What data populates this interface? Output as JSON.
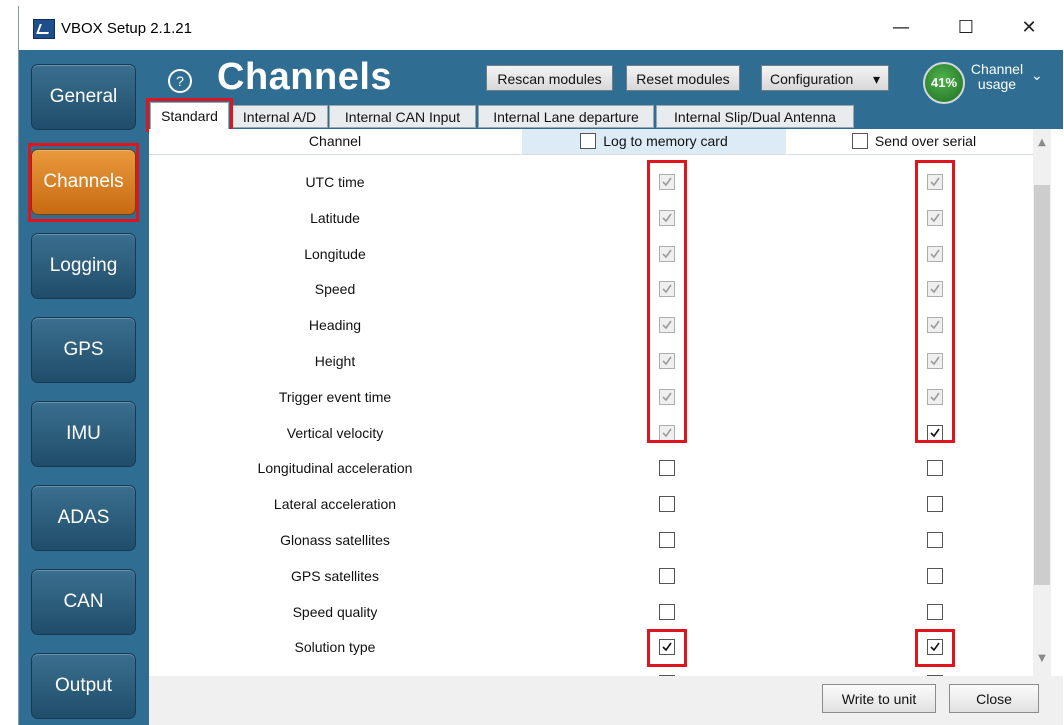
{
  "window": {
    "title": "VBOX Setup 2.1.21",
    "minimize_glyph": "—",
    "maximize_glyph": "☐",
    "close_glyph": "✕"
  },
  "sidebar": {
    "items": [
      {
        "label": "General",
        "active": false
      },
      {
        "label": "Channels",
        "active": true
      },
      {
        "label": "Logging",
        "active": false
      },
      {
        "label": "GPS",
        "active": false
      },
      {
        "label": "IMU",
        "active": false
      },
      {
        "label": "ADAS",
        "active": false
      },
      {
        "label": "CAN",
        "active": false
      },
      {
        "label": "Output",
        "active": false
      }
    ]
  },
  "header": {
    "help_glyph": "?",
    "title": "Channels",
    "rescan_label": "Rescan modules",
    "reset_label": "Reset modules",
    "configuration_label": "Configuration",
    "dropdown_glyph": "▾",
    "usage_percent": "41%",
    "usage_label": "Channel usage",
    "usage_chevron": "⌄"
  },
  "tabs": [
    "Standard",
    "Internal A/D",
    "Internal CAN Input",
    "Internal Lane departure",
    "Internal Slip/Dual Antenna"
  ],
  "table": {
    "headers": {
      "channel": "Channel",
      "log": "Log to memory card",
      "serial": "Send over serial"
    },
    "rows": [
      {
        "channel": "UTC time",
        "log": "checked-disabled",
        "serial": "checked-disabled"
      },
      {
        "channel": "Latitude",
        "log": "checked-disabled",
        "serial": "checked-disabled"
      },
      {
        "channel": "Longitude",
        "log": "checked-disabled",
        "serial": "checked-disabled"
      },
      {
        "channel": "Speed",
        "log": "checked-disabled",
        "serial": "checked-disabled"
      },
      {
        "channel": "Heading",
        "log": "checked-disabled",
        "serial": "checked-disabled"
      },
      {
        "channel": "Height",
        "log": "checked-disabled",
        "serial": "checked-disabled"
      },
      {
        "channel": "Trigger event time",
        "log": "checked-disabled",
        "serial": "checked-disabled"
      },
      {
        "channel": "Vertical velocity",
        "log": "checked-disabled",
        "serial": "checked"
      },
      {
        "channel": "Longitudinal acceleration",
        "log": "unchecked",
        "serial": "unchecked"
      },
      {
        "channel": "Lateral acceleration",
        "log": "unchecked",
        "serial": "unchecked"
      },
      {
        "channel": "Glonass satellites",
        "log": "unchecked",
        "serial": "unchecked"
      },
      {
        "channel": "GPS satellites",
        "log": "unchecked",
        "serial": "unchecked"
      },
      {
        "channel": "Speed quality",
        "log": "unchecked",
        "serial": "unchecked"
      },
      {
        "channel": "Solution type",
        "log": "checked",
        "serial": "checked"
      }
    ]
  },
  "footer": {
    "write_label": "Write to unit",
    "close_label": "Close"
  },
  "colors": {
    "accent": "#2f6d92",
    "active_nav": "#e28a2a",
    "highlight": "#e0141c",
    "usage_green": "#3a9a3a"
  }
}
